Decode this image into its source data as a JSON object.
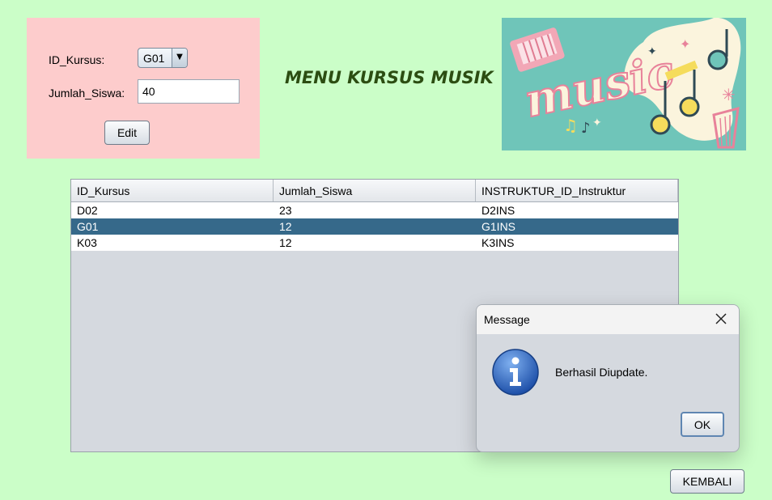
{
  "form": {
    "id_kursus_label": "ID_Kursus:",
    "id_kursus_value": "G01",
    "jumlah_siswa_label": "Jumlah_Siswa:",
    "jumlah_siswa_value": "40",
    "edit_label": "Edit"
  },
  "header": {
    "title": "MENU KURSUS MUSIK",
    "image_text": "music"
  },
  "table": {
    "columns": [
      "ID_Kursus",
      "Jumlah_Siswa",
      "INSTRUKTUR_ID_Instruktur"
    ],
    "rows": [
      [
        "D02",
        "23",
        "D2INS"
      ],
      [
        "G01",
        "12",
        "G1INS"
      ],
      [
        "K03",
        "12",
        "K3INS"
      ]
    ],
    "selected_row": 1,
    "selection_color": "#36698a"
  },
  "dialog": {
    "title": "Message",
    "message": "Berhasil Diupdate.",
    "ok_label": "OK",
    "icon": "info-icon",
    "close_icon": "close-icon"
  },
  "footer": {
    "kembali_label": "KEMBALI"
  },
  "colors": {
    "background": "#cbfec8",
    "form_panel": "#fdcccc",
    "title_color": "#2c4d12",
    "image_bg": "#6fc5b9"
  }
}
